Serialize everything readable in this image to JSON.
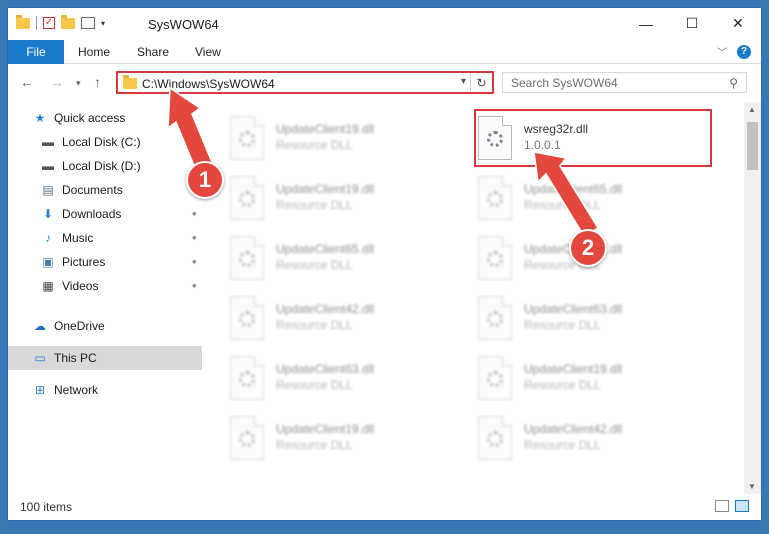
{
  "window": {
    "title": "SysWOW64",
    "controls": {
      "minimize": "—",
      "maximize": "☐",
      "close": "✕"
    }
  },
  "ribbon": {
    "tabs": [
      {
        "label": "File"
      },
      {
        "label": "Home"
      },
      {
        "label": "Share"
      },
      {
        "label": "View"
      }
    ],
    "help": "?"
  },
  "nav": {
    "address": "C:\\Windows\\SysWOW64",
    "search_placeholder": "Search SysWOW64"
  },
  "sidebar": {
    "items": [
      {
        "label": "Quick access",
        "icon": "star-icon"
      },
      {
        "label": "Local Disk (C:)",
        "icon": "drive-icon"
      },
      {
        "label": "Local Disk (D:)",
        "icon": "drive-icon"
      },
      {
        "label": "Documents",
        "icon": "documents-icon"
      },
      {
        "label": "Downloads",
        "icon": "download-icon"
      },
      {
        "label": "Music",
        "icon": "music-icon"
      },
      {
        "label": "Pictures",
        "icon": "pictures-icon"
      },
      {
        "label": "Videos",
        "icon": "videos-icon"
      },
      {
        "label": "OneDrive",
        "icon": "cloud-icon"
      },
      {
        "label": "This PC",
        "icon": "computer-icon"
      },
      {
        "label": "Network",
        "icon": "network-icon"
      }
    ]
  },
  "files": {
    "highlight": {
      "name": "wsreg32r.dll",
      "sub": "1.0.0.1"
    },
    "col1": [
      {
        "name": "UpdateClient19.dll",
        "sub": "Resource DLL"
      },
      {
        "name": "UpdateClient19.dll",
        "sub": "Resource DLL"
      },
      {
        "name": "UpdateClient65.dll",
        "sub": "Resource DLL"
      },
      {
        "name": "UpdateClient42.dll",
        "sub": "Resource DLL"
      },
      {
        "name": "UpdateClient63.dll",
        "sub": "Resource DLL"
      },
      {
        "name": "UpdateClient19.dll",
        "sub": "Resource DLL"
      }
    ],
    "col2": [
      {
        "name": "UpdateClient65.dll",
        "sub": "Resource DLL"
      },
      {
        "name": "UpdateClient21.dll",
        "sub": "Resource DLL"
      },
      {
        "name": "UpdateClient63.dll",
        "sub": "Resource DLL"
      },
      {
        "name": "UpdateClient19.dll",
        "sub": "Resource DLL"
      },
      {
        "name": "UpdateClient42.dll",
        "sub": "Resource DLL"
      }
    ]
  },
  "status": {
    "count": "100 items"
  },
  "callouts": {
    "one": "1",
    "two": "2"
  },
  "colors": {
    "accent": "#1979ca",
    "highlight": "#d9363e",
    "callout": "#e4473d"
  }
}
